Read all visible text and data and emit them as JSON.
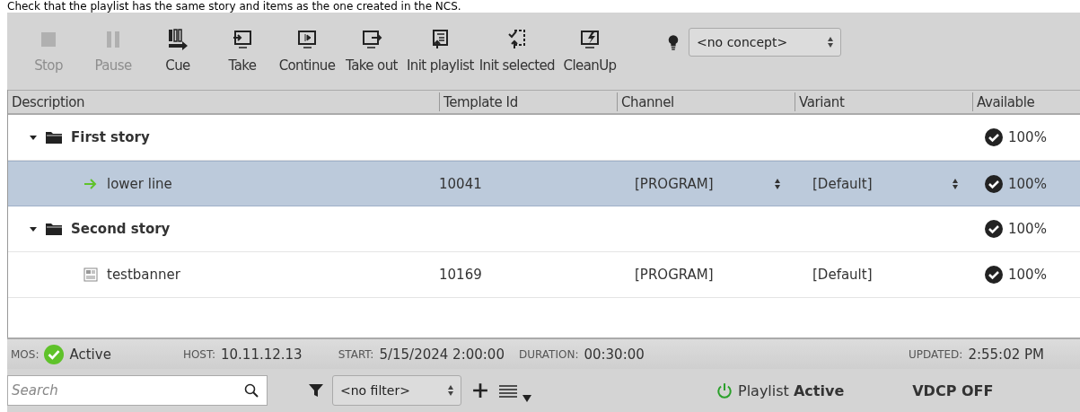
{
  "caption": "Check that the playlist has the same story and items as the one created in the NCS.",
  "toolbar": {
    "buttons": [
      {
        "label": "Stop",
        "disabled": true
      },
      {
        "label": "Pause",
        "disabled": true
      },
      {
        "label": "Cue",
        "disabled": false
      },
      {
        "label": "Take",
        "disabled": false
      },
      {
        "label": "Continue",
        "disabled": false
      },
      {
        "label": "Take out",
        "disabled": false
      },
      {
        "label": "Init playlist",
        "disabled": false
      },
      {
        "label": "Init selected",
        "disabled": false
      },
      {
        "label": "CleanUp",
        "disabled": false
      }
    ],
    "concept": "<no concept>"
  },
  "table": {
    "columns": [
      "Description",
      "Template Id",
      "Channel",
      "Variant",
      "Available"
    ],
    "rows": [
      {
        "kind": "story",
        "description": "First story",
        "expanded": true,
        "available": "100%",
        "children": [
          {
            "kind": "current",
            "description": "lower line",
            "template_id": "10041",
            "channel": "[PROGRAM]",
            "variant": "[Default]",
            "available": "100%",
            "selected": true
          }
        ]
      },
      {
        "kind": "story",
        "description": "Second story",
        "expanded": true,
        "available": "100%",
        "children": [
          {
            "kind": "template",
            "description": "testbanner",
            "template_id": "10169",
            "channel": "[PROGRAM]",
            "variant": "[Default]",
            "available": "100%",
            "selected": false
          }
        ]
      }
    ]
  },
  "status_bar": {
    "fields": [
      {
        "label": "MOS:",
        "value": "Active",
        "kind": "mos"
      },
      {
        "label": "HOST:",
        "value": "10.11.12.13",
        "kind": "text"
      },
      {
        "label": "START:",
        "value": "5/15/2024 2:00:00",
        "kind": "text"
      },
      {
        "label": "DURATION:",
        "value": "00:30:00",
        "kind": "text"
      },
      {
        "label": "UPDATED:",
        "value": "2:55:02 PM",
        "kind": "text"
      }
    ]
  },
  "bottom_bar": {
    "search": {
      "placeholder": "Search"
    },
    "filter": "<no filter>",
    "playlist_label": "Playlist",
    "playlist_state": "Active",
    "vdcp": "VDCP OFF"
  }
}
